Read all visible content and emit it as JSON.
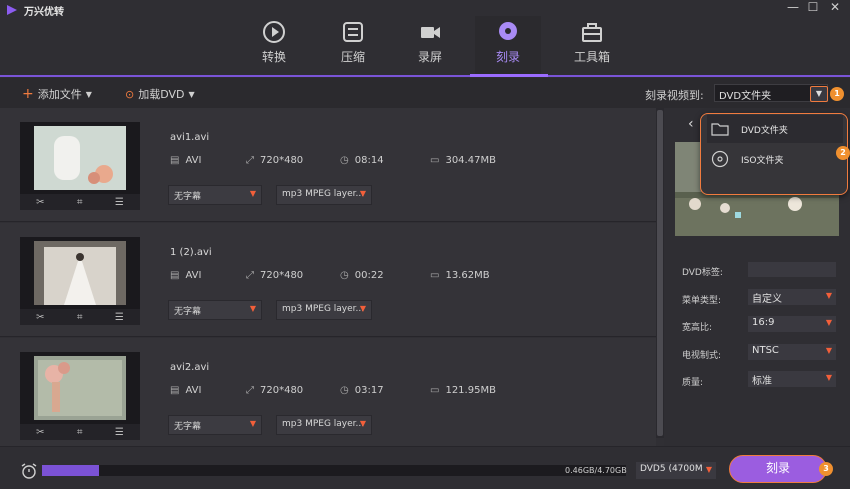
{
  "app": {
    "title": "万兴优转",
    "window_controls": [
      "minimize-icon",
      "maximize-icon",
      "close-icon"
    ]
  },
  "nav": {
    "tabs": [
      {
        "label": "转换",
        "icon": "convert-icon",
        "active": false
      },
      {
        "label": "压缩",
        "icon": "compress-icon",
        "active": false
      },
      {
        "label": "录屏",
        "icon": "record-icon",
        "active": false
      },
      {
        "label": "刻录",
        "icon": "burn-icon",
        "active": true
      },
      {
        "label": "工具箱",
        "icon": "toolbox-icon",
        "active": false
      }
    ],
    "accent": "#9b6cff"
  },
  "toolbar": {
    "add_file": "添加文件",
    "load_dvd": "加载DVD",
    "burn_to_label": "刻录视频到:",
    "burn_to_value": "DVD文件夹",
    "badge1": "1"
  },
  "videos": [
    {
      "name": "avi1.avi",
      "format": "AVI",
      "resolution": "720*480",
      "duration": "08:14",
      "size": "304.47MB",
      "subtitle": "无字幕",
      "audio": "mp3 MPEG layer..."
    },
    {
      "name": "1 (2).avi",
      "format": "AVI",
      "resolution": "720*480",
      "duration": "00:22",
      "size": "13.62MB",
      "subtitle": "无字幕",
      "audio": "mp3 MPEG layer..."
    },
    {
      "name": "avi2.avi",
      "format": "AVI",
      "resolution": "720*480",
      "duration": "03:17",
      "size": "121.95MB",
      "subtitle": "无字幕",
      "audio": "mp3 MPEG layer..."
    }
  ],
  "dropdown": {
    "items": [
      {
        "label": "DVD文件夹",
        "icon": "folder-icon"
      },
      {
        "label": "ISO文件夹",
        "icon": "disc-icon"
      }
    ],
    "badge2": "2"
  },
  "settings": {
    "dvd_label": {
      "label": "DVD标签:",
      "value": ""
    },
    "menu_type": {
      "label": "菜单类型:",
      "value": "自定义"
    },
    "aspect": {
      "label": "宽高比:",
      "value": "16:9"
    },
    "tv_standard": {
      "label": "电视制式:",
      "value": "NTSC"
    },
    "quality": {
      "label": "质量:",
      "value": "标准"
    }
  },
  "footer": {
    "capacity": "0.46GB/4.70GB",
    "capacity_fraction": 0.098,
    "disc_type": "DVD5 (4700M",
    "burn_button": "刻录",
    "badge3": "3"
  }
}
